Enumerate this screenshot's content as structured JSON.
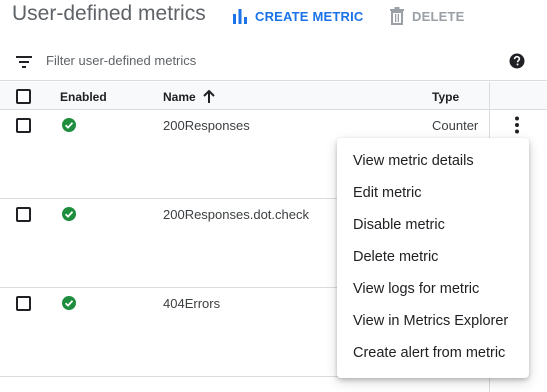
{
  "header": {
    "title": "User-defined metrics",
    "create_label": "CREATE METRIC",
    "delete_label": "DELETE"
  },
  "filter": {
    "placeholder": "Filter user-defined metrics"
  },
  "table": {
    "columns": {
      "enabled": "Enabled",
      "name": "Name",
      "type": "Type"
    },
    "rows": [
      {
        "name": "200Responses",
        "type": "Counter",
        "enabled": true
      },
      {
        "name": "200Responses.dot.check",
        "type": "",
        "enabled": true
      },
      {
        "name": "404Errors",
        "type": "",
        "enabled": true
      }
    ]
  },
  "menu": {
    "items": [
      "View metric details",
      "Edit metric",
      "Disable metric",
      "Delete metric",
      "View logs for metric",
      "View in Metrics Explorer",
      "Create alert from metric"
    ]
  },
  "colors": {
    "accent": "#1a73e8",
    "enabled_green": "#1e8e3e",
    "disabled_gray": "#9aa0a6"
  },
  "icons": {
    "create": "bar-chart-icon",
    "delete": "trash-icon",
    "filter": "filter-icon",
    "help": "help-icon",
    "sort": "arrow-up-icon",
    "enabled": "check-circle-icon",
    "row_menu": "more-vert-icon"
  }
}
